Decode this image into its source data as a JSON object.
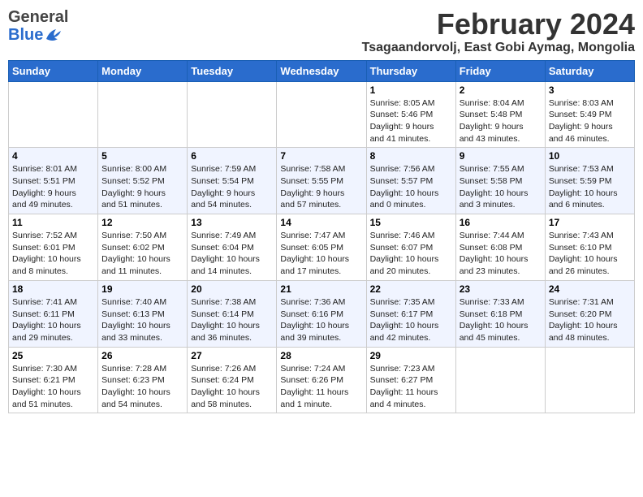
{
  "header": {
    "logo_general": "General",
    "logo_blue": "Blue",
    "month_title": "February 2024",
    "location": "Tsagaandorvolj, East Gobi Aymag, Mongolia"
  },
  "days_of_week": [
    "Sunday",
    "Monday",
    "Tuesday",
    "Wednesday",
    "Thursday",
    "Friday",
    "Saturday"
  ],
  "weeks": [
    [
      {
        "day": "",
        "info": ""
      },
      {
        "day": "",
        "info": ""
      },
      {
        "day": "",
        "info": ""
      },
      {
        "day": "",
        "info": ""
      },
      {
        "day": "1",
        "info": "Sunrise: 8:05 AM\nSunset: 5:46 PM\nDaylight: 9 hours\nand 41 minutes."
      },
      {
        "day": "2",
        "info": "Sunrise: 8:04 AM\nSunset: 5:48 PM\nDaylight: 9 hours\nand 43 minutes."
      },
      {
        "day": "3",
        "info": "Sunrise: 8:03 AM\nSunset: 5:49 PM\nDaylight: 9 hours\nand 46 minutes."
      }
    ],
    [
      {
        "day": "4",
        "info": "Sunrise: 8:01 AM\nSunset: 5:51 PM\nDaylight: 9 hours\nand 49 minutes."
      },
      {
        "day": "5",
        "info": "Sunrise: 8:00 AM\nSunset: 5:52 PM\nDaylight: 9 hours\nand 51 minutes."
      },
      {
        "day": "6",
        "info": "Sunrise: 7:59 AM\nSunset: 5:54 PM\nDaylight: 9 hours\nand 54 minutes."
      },
      {
        "day": "7",
        "info": "Sunrise: 7:58 AM\nSunset: 5:55 PM\nDaylight: 9 hours\nand 57 minutes."
      },
      {
        "day": "8",
        "info": "Sunrise: 7:56 AM\nSunset: 5:57 PM\nDaylight: 10 hours\nand 0 minutes."
      },
      {
        "day": "9",
        "info": "Sunrise: 7:55 AM\nSunset: 5:58 PM\nDaylight: 10 hours\nand 3 minutes."
      },
      {
        "day": "10",
        "info": "Sunrise: 7:53 AM\nSunset: 5:59 PM\nDaylight: 10 hours\nand 6 minutes."
      }
    ],
    [
      {
        "day": "11",
        "info": "Sunrise: 7:52 AM\nSunset: 6:01 PM\nDaylight: 10 hours\nand 8 minutes."
      },
      {
        "day": "12",
        "info": "Sunrise: 7:50 AM\nSunset: 6:02 PM\nDaylight: 10 hours\nand 11 minutes."
      },
      {
        "day": "13",
        "info": "Sunrise: 7:49 AM\nSunset: 6:04 PM\nDaylight: 10 hours\nand 14 minutes."
      },
      {
        "day": "14",
        "info": "Sunrise: 7:47 AM\nSunset: 6:05 PM\nDaylight: 10 hours\nand 17 minutes."
      },
      {
        "day": "15",
        "info": "Sunrise: 7:46 AM\nSunset: 6:07 PM\nDaylight: 10 hours\nand 20 minutes."
      },
      {
        "day": "16",
        "info": "Sunrise: 7:44 AM\nSunset: 6:08 PM\nDaylight: 10 hours\nand 23 minutes."
      },
      {
        "day": "17",
        "info": "Sunrise: 7:43 AM\nSunset: 6:10 PM\nDaylight: 10 hours\nand 26 minutes."
      }
    ],
    [
      {
        "day": "18",
        "info": "Sunrise: 7:41 AM\nSunset: 6:11 PM\nDaylight: 10 hours\nand 29 minutes."
      },
      {
        "day": "19",
        "info": "Sunrise: 7:40 AM\nSunset: 6:13 PM\nDaylight: 10 hours\nand 33 minutes."
      },
      {
        "day": "20",
        "info": "Sunrise: 7:38 AM\nSunset: 6:14 PM\nDaylight: 10 hours\nand 36 minutes."
      },
      {
        "day": "21",
        "info": "Sunrise: 7:36 AM\nSunset: 6:16 PM\nDaylight: 10 hours\nand 39 minutes."
      },
      {
        "day": "22",
        "info": "Sunrise: 7:35 AM\nSunset: 6:17 PM\nDaylight: 10 hours\nand 42 minutes."
      },
      {
        "day": "23",
        "info": "Sunrise: 7:33 AM\nSunset: 6:18 PM\nDaylight: 10 hours\nand 45 minutes."
      },
      {
        "day": "24",
        "info": "Sunrise: 7:31 AM\nSunset: 6:20 PM\nDaylight: 10 hours\nand 48 minutes."
      }
    ],
    [
      {
        "day": "25",
        "info": "Sunrise: 7:30 AM\nSunset: 6:21 PM\nDaylight: 10 hours\nand 51 minutes."
      },
      {
        "day": "26",
        "info": "Sunrise: 7:28 AM\nSunset: 6:23 PM\nDaylight: 10 hours\nand 54 minutes."
      },
      {
        "day": "27",
        "info": "Sunrise: 7:26 AM\nSunset: 6:24 PM\nDaylight: 10 hours\nand 58 minutes."
      },
      {
        "day": "28",
        "info": "Sunrise: 7:24 AM\nSunset: 6:26 PM\nDaylight: 11 hours\nand 1 minute."
      },
      {
        "day": "29",
        "info": "Sunrise: 7:23 AM\nSunset: 6:27 PM\nDaylight: 11 hours\nand 4 minutes."
      },
      {
        "day": "",
        "info": ""
      },
      {
        "day": "",
        "info": ""
      }
    ]
  ]
}
